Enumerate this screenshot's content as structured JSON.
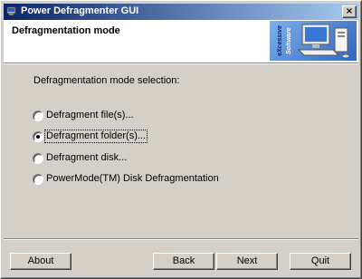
{
  "window": {
    "title": "Power Defragmenter GUI",
    "close_glyph": "×"
  },
  "header": {
    "title": "Defragmentation mode",
    "logo": {
      "line1": "eXcessive",
      "line2": "Software"
    }
  },
  "main": {
    "section_label": "Defragmentation mode selection:",
    "options": [
      {
        "label": "Defragment file(s)...",
        "selected": false
      },
      {
        "label": "Defragment folder(s)...",
        "selected": true
      },
      {
        "label": "Defragment disk...",
        "selected": false
      },
      {
        "label": "PowerMode(TM) Disk Defragmentation",
        "selected": false
      }
    ]
  },
  "footer": {
    "about": "About",
    "back": "Back",
    "next": "Next",
    "quit": "Quit"
  },
  "colors": {
    "titlebar_start": "#0a246a",
    "titlebar_end": "#a6caf0",
    "face": "#d4d0c8"
  }
}
